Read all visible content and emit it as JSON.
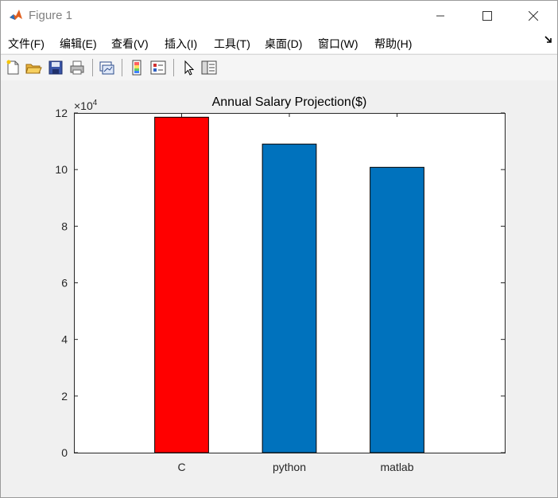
{
  "window": {
    "title": "Figure 1"
  },
  "menu": [
    {
      "label": "文件(F)"
    },
    {
      "label": "编辑(E)"
    },
    {
      "label": "查看(V)"
    },
    {
      "label": "插入(I)"
    },
    {
      "label": "工具(T)"
    },
    {
      "label": "桌面(D)"
    },
    {
      "label": "窗口(W)"
    },
    {
      "label": "帮助(H)"
    }
  ],
  "toolbar": {
    "icons": [
      "new-figure-icon",
      "open-file-icon",
      "save-icon",
      "print-icon",
      "link-plot-icon",
      "colorbar-icon",
      "legend-icon",
      "pointer-icon",
      "property-editor-icon"
    ]
  },
  "chart_data": {
    "type": "bar",
    "title": "Annual Salary Projection($)",
    "categories": [
      "C",
      "python",
      "matlab"
    ],
    "values": [
      118500,
      109000,
      100800
    ],
    "bar_colors": [
      "#ff0000",
      "#0072bd",
      "#0072bd"
    ],
    "ylim": [
      0,
      120000
    ],
    "yticks": [
      0,
      2,
      4,
      6,
      8,
      10,
      12
    ],
    "y_exponent_label": "×10",
    "y_exponent": "4",
    "xlabel": "",
    "ylabel": ""
  }
}
